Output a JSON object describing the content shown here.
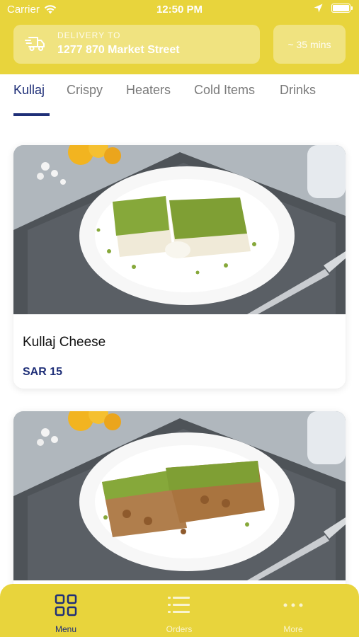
{
  "status_bar": {
    "carrier": "Carrier",
    "time": "12:50 PM"
  },
  "header": {
    "delivery_label": "DELIVERY TO",
    "delivery_address": "1277 870 Market Street",
    "eta": "~ 35 mins"
  },
  "tabs": [
    {
      "label": "Kullaj",
      "active": true
    },
    {
      "label": "Crispy",
      "active": false
    },
    {
      "label": "Heaters",
      "active": false
    },
    {
      "label": "Cold Items",
      "active": false
    },
    {
      "label": "Drinks",
      "active": false
    }
  ],
  "products": [
    {
      "name": "Kullaj Cheese",
      "price": "SAR 15",
      "image": "kullaj-cheese-photo"
    },
    {
      "name": "",
      "price": "",
      "image": "kullaj-walnut-photo"
    }
  ],
  "tabbar": [
    {
      "label": "Menu",
      "icon": "grid-icon",
      "active": true
    },
    {
      "label": "Orders",
      "icon": "list-icon",
      "active": false
    },
    {
      "label": "More",
      "icon": "more-dots-icon",
      "active": false
    }
  ],
  "colors": {
    "brand_yellow": "#e8d43c",
    "accent_navy": "#1f2f78",
    "inactive_gray": "#7a7a7a"
  }
}
